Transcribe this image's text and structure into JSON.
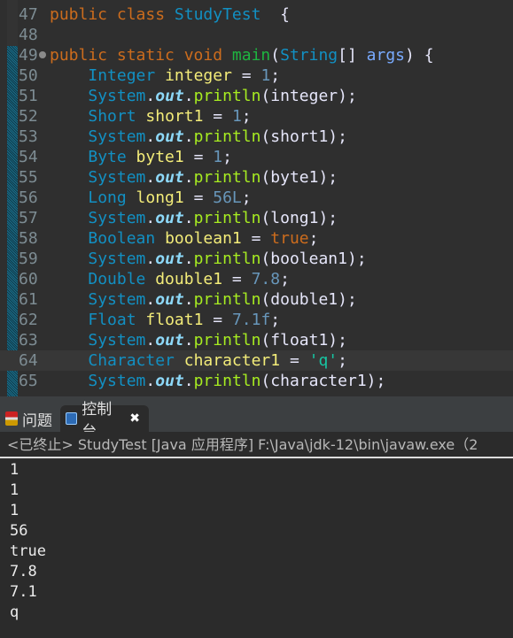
{
  "editor": {
    "current_line": 64,
    "lines": [
      {
        "n": "47",
        "fold": false,
        "tokens": [
          [
            "kw",
            "public class "
          ],
          [
            "type",
            "StudyTest"
          ],
          [
            "plain",
            "  {"
          ]
        ]
      },
      {
        "n": "48",
        "fold": false,
        "tokens": []
      },
      {
        "n": "49",
        "fold": true,
        "tokens": [
          [
            "kw",
            "public static void "
          ],
          [
            "main",
            "main"
          ],
          [
            "plain",
            "("
          ],
          [
            "type",
            "String"
          ],
          [
            "plain",
            "[] "
          ],
          [
            "param",
            "args"
          ],
          [
            "plain",
            ") {"
          ]
        ]
      },
      {
        "n": "50",
        "fold": false,
        "tokens": [
          [
            "plain",
            "    "
          ],
          [
            "type",
            "Integer "
          ],
          [
            "var",
            "integer"
          ],
          [
            "plain",
            " = "
          ],
          [
            "num",
            "1"
          ],
          [
            "plain",
            ";"
          ]
        ]
      },
      {
        "n": "51",
        "fold": false,
        "tokens": [
          [
            "plain",
            "    "
          ],
          [
            "type",
            "System"
          ],
          [
            "plain",
            "."
          ],
          [
            "field",
            "out"
          ],
          [
            "plain",
            "."
          ],
          [
            "method",
            "println"
          ],
          [
            "plain",
            "(integer);"
          ]
        ]
      },
      {
        "n": "52",
        "fold": false,
        "tokens": [
          [
            "plain",
            "    "
          ],
          [
            "type",
            "Short "
          ],
          [
            "var",
            "short1"
          ],
          [
            "plain",
            " = "
          ],
          [
            "num",
            "1"
          ],
          [
            "plain",
            ";"
          ]
        ]
      },
      {
        "n": "53",
        "fold": false,
        "tokens": [
          [
            "plain",
            "    "
          ],
          [
            "type",
            "System"
          ],
          [
            "plain",
            "."
          ],
          [
            "field",
            "out"
          ],
          [
            "plain",
            "."
          ],
          [
            "method",
            "println"
          ],
          [
            "plain",
            "(short1);"
          ]
        ]
      },
      {
        "n": "54",
        "fold": false,
        "tokens": [
          [
            "plain",
            "    "
          ],
          [
            "type",
            "Byte "
          ],
          [
            "var",
            "byte1"
          ],
          [
            "plain",
            " = "
          ],
          [
            "num",
            "1"
          ],
          [
            "plain",
            ";"
          ]
        ]
      },
      {
        "n": "55",
        "fold": false,
        "tokens": [
          [
            "plain",
            "    "
          ],
          [
            "type",
            "System"
          ],
          [
            "plain",
            "."
          ],
          [
            "field",
            "out"
          ],
          [
            "plain",
            "."
          ],
          [
            "method",
            "println"
          ],
          [
            "plain",
            "(byte1);"
          ]
        ]
      },
      {
        "n": "56",
        "fold": false,
        "tokens": [
          [
            "plain",
            "    "
          ],
          [
            "type",
            "Long "
          ],
          [
            "var",
            "long1"
          ],
          [
            "plain",
            " = "
          ],
          [
            "num",
            "56L"
          ],
          [
            "plain",
            ";"
          ]
        ]
      },
      {
        "n": "57",
        "fold": false,
        "tokens": [
          [
            "plain",
            "    "
          ],
          [
            "type",
            "System"
          ],
          [
            "plain",
            "."
          ],
          [
            "field",
            "out"
          ],
          [
            "plain",
            "."
          ],
          [
            "method",
            "println"
          ],
          [
            "plain",
            "(long1);"
          ]
        ]
      },
      {
        "n": "58",
        "fold": false,
        "tokens": [
          [
            "plain",
            "    "
          ],
          [
            "type",
            "Boolean "
          ],
          [
            "var",
            "boolean1"
          ],
          [
            "plain",
            " = "
          ],
          [
            "kw",
            "true"
          ],
          [
            "plain",
            ";"
          ]
        ]
      },
      {
        "n": "59",
        "fold": false,
        "tokens": [
          [
            "plain",
            "    "
          ],
          [
            "type",
            "System"
          ],
          [
            "plain",
            "."
          ],
          [
            "field",
            "out"
          ],
          [
            "plain",
            "."
          ],
          [
            "method",
            "println"
          ],
          [
            "plain",
            "(boolean1);"
          ]
        ]
      },
      {
        "n": "60",
        "fold": false,
        "tokens": [
          [
            "plain",
            "    "
          ],
          [
            "type",
            "Double "
          ],
          [
            "var",
            "double1"
          ],
          [
            "plain",
            " = "
          ],
          [
            "num",
            "7.8"
          ],
          [
            "plain",
            ";"
          ]
        ]
      },
      {
        "n": "61",
        "fold": false,
        "tokens": [
          [
            "plain",
            "    "
          ],
          [
            "type",
            "System"
          ],
          [
            "plain",
            "."
          ],
          [
            "field",
            "out"
          ],
          [
            "plain",
            "."
          ],
          [
            "method",
            "println"
          ],
          [
            "plain",
            "(double1);"
          ]
        ]
      },
      {
        "n": "62",
        "fold": false,
        "tokens": [
          [
            "plain",
            "    "
          ],
          [
            "type",
            "Float "
          ],
          [
            "var",
            "float1"
          ],
          [
            "plain",
            " = "
          ],
          [
            "num",
            "7.1f"
          ],
          [
            "plain",
            ";"
          ]
        ]
      },
      {
        "n": "63",
        "fold": false,
        "tokens": [
          [
            "plain",
            "    "
          ],
          [
            "type",
            "System"
          ],
          [
            "plain",
            "."
          ],
          [
            "field",
            "out"
          ],
          [
            "plain",
            "."
          ],
          [
            "method",
            "println"
          ],
          [
            "plain",
            "(float1);"
          ]
        ]
      },
      {
        "n": "64",
        "fold": false,
        "tokens": [
          [
            "plain",
            "    "
          ],
          [
            "type",
            "Character "
          ],
          [
            "var",
            "character1"
          ],
          [
            "plain",
            " = "
          ],
          [
            "str",
            "'q'"
          ],
          [
            "plain",
            ";"
          ]
        ]
      },
      {
        "n": "65",
        "fold": false,
        "tokens": [
          [
            "plain",
            "    "
          ],
          [
            "type",
            "System"
          ],
          [
            "plain",
            "."
          ],
          [
            "field",
            "out"
          ],
          [
            "plain",
            "."
          ],
          [
            "method",
            "println"
          ],
          [
            "plain",
            "(character1);"
          ]
        ]
      }
    ]
  },
  "tabs": {
    "problems": "问题",
    "console": "控制台",
    "close": "✖"
  },
  "console": {
    "header": "<已终止> StudyTest [Java 应用程序] F:\\Java\\jdk-12\\bin\\javaw.exe（2",
    "output": [
      "1",
      "1",
      "1",
      "56",
      "true",
      "7.8",
      "7.1",
      "q"
    ]
  }
}
